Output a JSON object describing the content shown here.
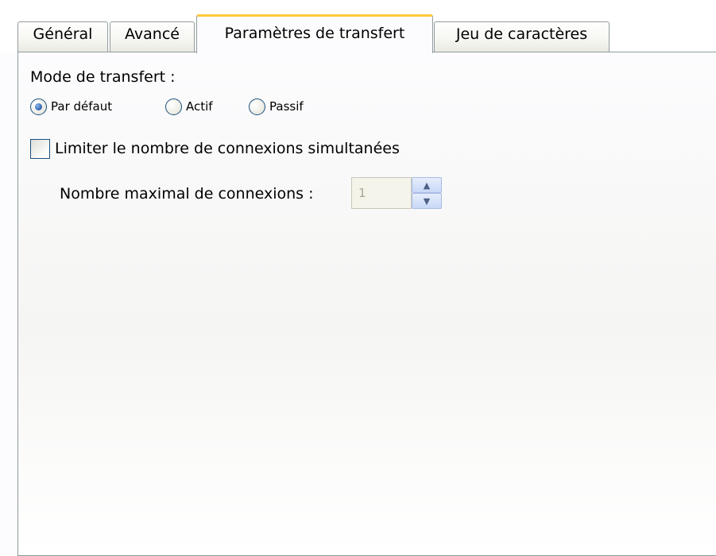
{
  "tabs": [
    {
      "label": "Général",
      "active": false
    },
    {
      "label": "Avancé",
      "active": false
    },
    {
      "label": "Paramètres de transfert",
      "active": true
    },
    {
      "label": "Jeu de caractères",
      "active": false
    }
  ],
  "transfer": {
    "mode_label": "Mode de transfert :",
    "radios": [
      {
        "label": "Par défaut",
        "checked": true
      },
      {
        "label": "Actif",
        "checked": false
      },
      {
        "label": "Passif",
        "checked": false
      }
    ],
    "limit_checkbox_label": "Limiter le nombre de connexions simultanées",
    "limit_checked": false,
    "max_connections_label": "Nombre maximal de connexions :",
    "max_connections_value": "1",
    "max_connections_enabled": false
  },
  "icons": {
    "spin_up": "spin-up-arrow-icon",
    "spin_down": "spin-down-arrow-icon"
  },
  "colors": {
    "active_tab_accent": "#ffc83c",
    "control_border": "#1c5180",
    "tab_border": "#919b9c"
  }
}
